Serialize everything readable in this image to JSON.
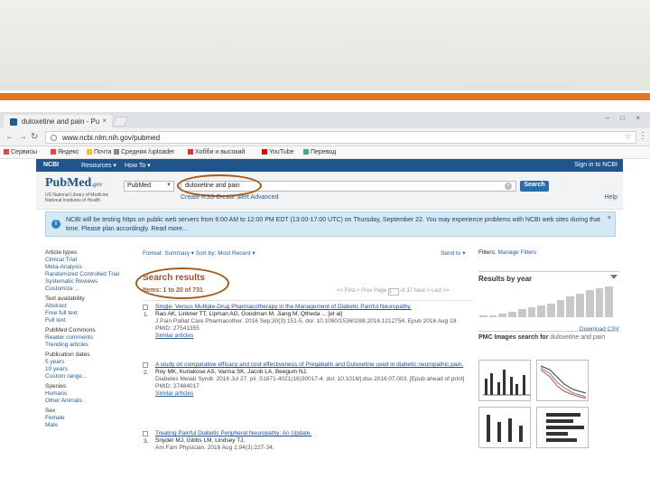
{
  "browser": {
    "tab_title": "duloxetine and pain - Pu",
    "tab_close": "×",
    "url": "www.ncbi.nlm.nih.gov/pubmed",
    "bookmarks": [
      "Сервисы",
      "Яндекс",
      "Почта",
      "Средняя /uploader",
      "Хобби и высокий",
      "YouTube",
      "Перевод"
    ]
  },
  "ncbi": {
    "brand": "NCBI",
    "resources": "Resources ▾",
    "howto": "How To ▾",
    "signin": "Sign in to NCBI"
  },
  "header": {
    "logo": "PubMed",
    "logo_suffix": ".gov",
    "logo_sub": "US National Library of Medicine National Institutes of Health",
    "db_select": "PubMed",
    "query": "duloxetine and pain",
    "search_button": "Search",
    "sublinks": "Create RSS   Create alert   Advanced",
    "help": "Help"
  },
  "notice": {
    "text": "NCBI will be testing https on public web servers from 6:00 AM to 12:00 PM EDT (13:00-17:00 UTC) on Thursday, September 22. You may experience problems with NCBI web sites during that time. Please plan accordingly. Read more..."
  },
  "left_filters": [
    {
      "heading": "Article types",
      "items": [
        "Clinical Trial",
        "Meta-Analysis",
        "Randomized Controlled Trial",
        "Systematic Reviews",
        "Customize ..."
      ]
    },
    {
      "heading": "Text availability",
      "items": [
        "Abstract",
        "Free full text",
        "Full text"
      ]
    },
    {
      "heading": "PubMed Commons",
      "items": [
        "Reader comments",
        "Trending articles"
      ]
    },
    {
      "heading": "Publication dates",
      "items": [
        "5 years",
        "10 years",
        "Custom range..."
      ]
    },
    {
      "heading": "Species",
      "items": [
        "Humans",
        "Other Animals"
      ]
    },
    {
      "heading": "Sex",
      "items": [
        "Female",
        "Male"
      ]
    }
  ],
  "results_bar": {
    "format": "Format: Summary ▾   Sort by: Most Recent ▾",
    "sendto": "Send to ▾"
  },
  "results": {
    "heading": "Search results",
    "items_label": "Items: 1 to 20 of 731",
    "pager": "<< First  < Prev  Page",
    "page_num": "1",
    "pager_tail": "of 37  Next >  Last >>"
  },
  "result_list": [
    {
      "num": "1.",
      "title": "Single- Versus Multiple-Drug Pharmacotherapy in the Management of Diabetic Painful Neuropathy.",
      "authors": "Rao AK, Linkner TT, Lipman AG, Goodman M, Jiang M, Qtheda ... [et al]",
      "journal": "J Pain Palliat Care Pharmacother. 2016 Sep;30(3):151-5. doi: 10.1080/15360288.2016.1212754. Epub 2016 Aug 19.",
      "pmid": "PMID: 27541355",
      "similar": "Similar articles"
    },
    {
      "num": "2.",
      "title": "A study on comparative efficacy and cost effectiveness of Pregabalin and Duloxetine used in diabetic neuropathic pain.",
      "authors": "Roy MK, Kuriakose AS, Varma SK, Jacob LA, Beegum NJ.",
      "journal": "Diabetes Metab Syndr. 2016 Jul 27. pii: S1871-4021(16)30017-4. doi: 10.1016/j.dsx.2016.07.003. [Epub ahead of print]",
      "pmid": "PMID: 27484017",
      "similar": "Similar articles"
    },
    {
      "num": "3.",
      "title": "Treating Painful Diabetic Peripheral Neuropathy: An Update.",
      "authors": "Snyder MJ, Gibbs LM, Lindsey TJ.",
      "journal": "Am Fam Physician. 2016 Aug 1;94(3):227-34.",
      "pmid": "",
      "similar": ""
    }
  ],
  "right": {
    "filters": "Filters:",
    "manage": "Manage Filters",
    "year_heading": "Results by year",
    "year_bars": [
      1,
      1,
      2,
      3,
      4,
      5,
      6,
      7,
      9,
      11,
      12,
      14,
      15,
      16
    ],
    "download": "Download CSV",
    "pmc_heading": "PMC Images search for",
    "pmc_query": "duloxetine and pain"
  }
}
